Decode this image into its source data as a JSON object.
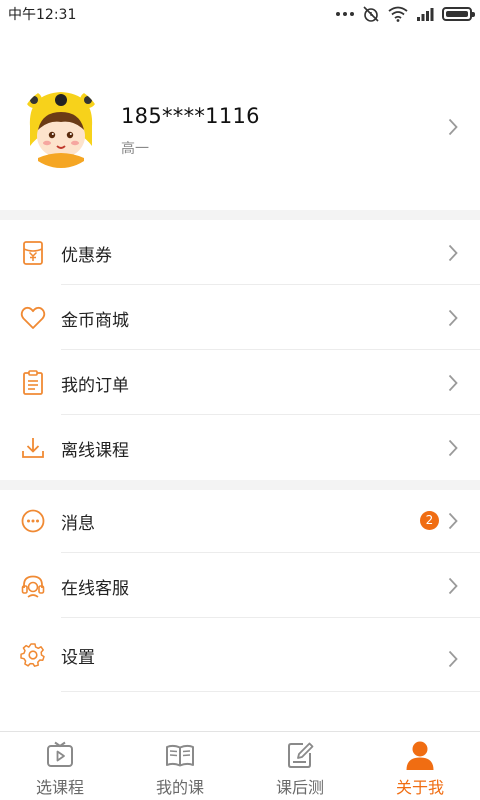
{
  "status_bar": {
    "time": "中午12:31",
    "icons": [
      "more-dots-icon",
      "alarm-off-icon",
      "wifi-icon",
      "signal-icon",
      "battery-icon"
    ]
  },
  "profile": {
    "phone": "185****1116",
    "grade": "高一",
    "avatar_icon": "cartoon-avatar-icon"
  },
  "menu_group_1": [
    {
      "label": "优惠券",
      "icon": "coupon-icon"
    },
    {
      "label": "金币商城",
      "icon": "heart-icon"
    },
    {
      "label": "我的订单",
      "icon": "order-list-icon"
    },
    {
      "label": "离线课程",
      "icon": "download-icon"
    }
  ],
  "menu_group_2": [
    {
      "label": "消息",
      "icon": "message-icon",
      "badge": "2"
    },
    {
      "label": "在线客服",
      "icon": "headset-icon"
    },
    {
      "label": "设置",
      "icon": "gear-icon"
    }
  ],
  "tabs": [
    {
      "label": "选课程",
      "icon": "video-play-icon",
      "active": false
    },
    {
      "label": "我的课",
      "icon": "book-icon",
      "active": false
    },
    {
      "label": "课后测",
      "icon": "edit-note-icon",
      "active": false
    },
    {
      "label": "关于我",
      "icon": "person-icon",
      "active": true
    }
  ],
  "colors": {
    "accent": "#f06d12",
    "icon_orange": "#f08a34",
    "text": "#222222",
    "secondary_text": "#8a8a8a",
    "divider": "#f3f3f3"
  }
}
